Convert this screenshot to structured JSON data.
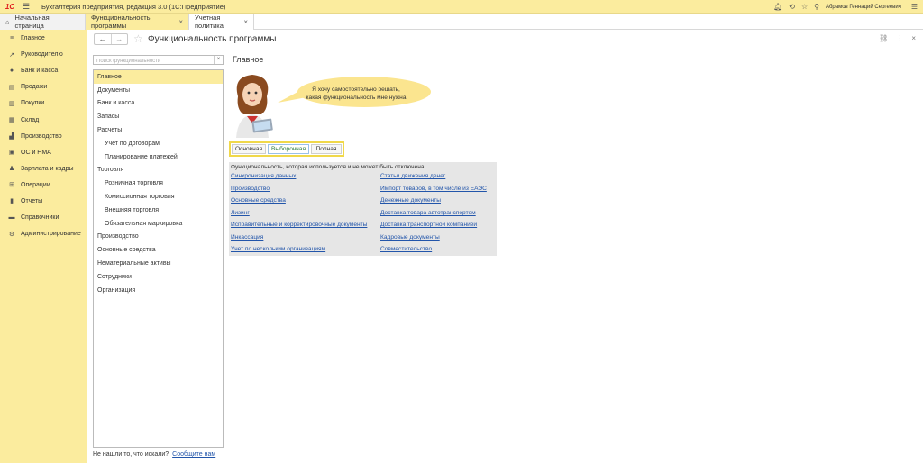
{
  "app": {
    "title": "Бухгалтерия предприятия, редакция 3.0  (1С:Предприятие)",
    "logo": "1С",
    "user": "Абрамов Геннадий Сергеевич"
  },
  "tabs": [
    {
      "label": "Начальная страница"
    },
    {
      "label": "Функциональность программы"
    },
    {
      "label": "Учетная политика"
    }
  ],
  "sidebar": {
    "items": [
      {
        "label": "Главное",
        "icon": "menu-lines-icon"
      },
      {
        "label": "Руководителю",
        "icon": "trend-chart-icon"
      },
      {
        "label": "Банк и касса",
        "icon": "coin-icon"
      },
      {
        "label": "Продажи",
        "icon": "cart-icon"
      },
      {
        "label": "Покупки",
        "icon": "basket-icon"
      },
      {
        "label": "Склад",
        "icon": "warehouse-icon"
      },
      {
        "label": "Производство",
        "icon": "factory-icon"
      },
      {
        "label": "ОС и НМА",
        "icon": "assets-icon"
      },
      {
        "label": "Зарплата и кадры",
        "icon": "person-icon"
      },
      {
        "label": "Операции",
        "icon": "operations-icon"
      },
      {
        "label": "Отчеты",
        "icon": "report-icon"
      },
      {
        "label": "Справочники",
        "icon": "book-icon"
      },
      {
        "label": "Администрирование",
        "icon": "gear-icon"
      }
    ]
  },
  "page": {
    "title": "Функциональность программы",
    "search_placeholder": "Поиск функциональности",
    "section_title": "Главное",
    "bubble_text_1": "Я хочу самостоятельно решать,",
    "bubble_text_2": "какая функциональность мне нужна",
    "modes": [
      "Основная",
      "Выборочная",
      "Полная"
    ],
    "selected_mode": "Выборочная",
    "func_header": "Функциональность, которая используется и не может быть отключена:",
    "func_links_left": [
      "Синхронизация данных",
      "Производство",
      "Основные средства",
      "Лизинг",
      "Исправительные и корректировочные документы",
      "Инкассация",
      "Учет по нескольким организациям"
    ],
    "func_links_right": [
      "Статьи движения денег",
      "Импорт товаров, в том числе из ЕАЭС",
      "Денежные документы",
      "Доставка товара автотранспортом",
      "Доставка транспортной компанией",
      "Кадровые документы",
      "Совместительство"
    ],
    "bottom_text": "Не нашли то, что искали?",
    "bottom_link": "Сообщите нам"
  },
  "tree": [
    {
      "label": "Главное",
      "level": 0
    },
    {
      "label": "Документы",
      "level": 0
    },
    {
      "label": "Банк и касса",
      "level": 0
    },
    {
      "label": "Запасы",
      "level": 0
    },
    {
      "label": "Расчеты",
      "level": 0
    },
    {
      "label": "Учет по договорам",
      "level": 1
    },
    {
      "label": "Планирование платежей",
      "level": 1
    },
    {
      "label": "Торговля",
      "level": 0
    },
    {
      "label": "Розничная торговля",
      "level": 1
    },
    {
      "label": "Комиссионная торговля",
      "level": 1
    },
    {
      "label": "Внешняя торговля",
      "level": 1
    },
    {
      "label": "Обязательная маркировка",
      "level": 1
    },
    {
      "label": "Производство",
      "level": 0
    },
    {
      "label": "Основные средства",
      "level": 0
    },
    {
      "label": "Нематериальные активы",
      "level": 0
    },
    {
      "label": "Сотрудники",
      "level": 0
    },
    {
      "label": "Организация",
      "level": 0
    }
  ]
}
